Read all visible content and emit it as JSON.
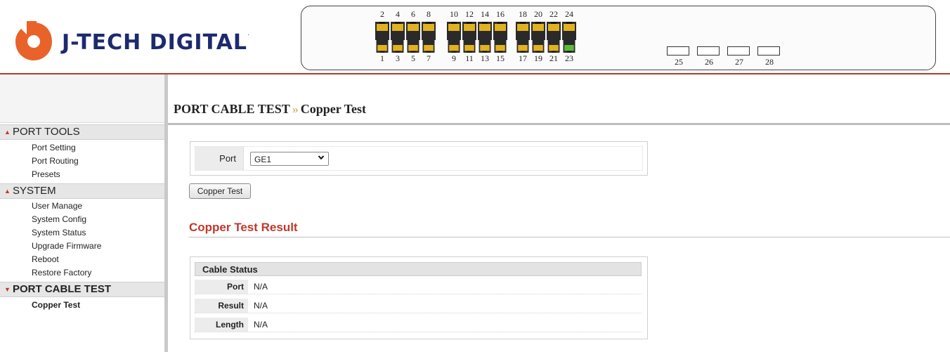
{
  "brand": {
    "name": "J-TECH DIGITAL",
    "mark": "."
  },
  "colors": {
    "accent_red": "#c0392b",
    "brand_navy": "#1d2a6e",
    "logo_orange": "#e8622a",
    "port_yellow": "#e2b11f",
    "port_active_green": "#5dbb3a"
  },
  "panel": {
    "top_ports": [
      "2",
      "4",
      "6",
      "8",
      "10",
      "12",
      "14",
      "16",
      "18",
      "20",
      "22",
      "24"
    ],
    "bottom_ports": [
      "1",
      "3",
      "5",
      "7",
      "9",
      "11",
      "13",
      "15",
      "17",
      "19",
      "21",
      "23"
    ],
    "active_port": "23",
    "sfp_ports": [
      "25",
      "26",
      "27",
      "28"
    ]
  },
  "sidebar": {
    "sections": [
      {
        "title": "PORT TOOLS",
        "icon": "caret-up-icon",
        "items": [
          "Port Setting",
          "Port Routing",
          "Presets"
        ]
      },
      {
        "title": "SYSTEM",
        "icon": "caret-up-icon",
        "items": [
          "User Manage",
          "System Config",
          "System Status",
          "Upgrade Firmware",
          "Reboot",
          "Restore Factory"
        ]
      },
      {
        "title": "PORT CABLE TEST",
        "icon": "caret-down-icon",
        "items": [
          "Copper Test"
        ]
      }
    ]
  },
  "breadcrumb": {
    "section": "PORT CABLE TEST",
    "separator": "»",
    "page": "Copper Test"
  },
  "form": {
    "port_label": "Port",
    "port_value": "GE1",
    "button_label": "Copper Test"
  },
  "result": {
    "title": "Copper Test Result",
    "table_title": "Cable Status",
    "rows": [
      {
        "label": "Port",
        "value": "N/A"
      },
      {
        "label": "Result",
        "value": "N/A"
      },
      {
        "label": "Length",
        "value": "N/A"
      }
    ]
  }
}
